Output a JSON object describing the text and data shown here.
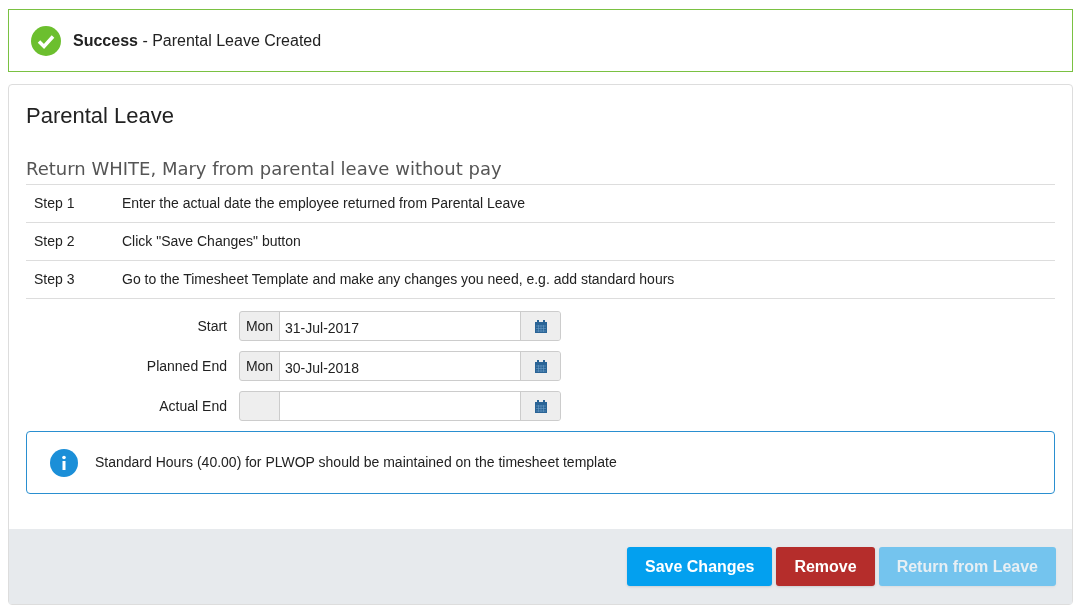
{
  "alert": {
    "title": "Success",
    "message": " - Parental Leave Created"
  },
  "panel": {
    "title": "Parental Leave",
    "subtitle": "Return WHITE, Mary from parental leave without pay"
  },
  "steps": [
    {
      "label": "Step 1",
      "text": "Enter the actual date the employee returned from Parental Leave"
    },
    {
      "label": "Step 2",
      "text": "Click \"Save Changes\" button"
    },
    {
      "label": "Step 3",
      "text": "Go to the Timesheet Template and make any changes you need, e.g. add standard hours"
    }
  ],
  "fields": [
    {
      "label": "Start",
      "day": "Mon",
      "value": "31-Jul-2017"
    },
    {
      "label": "Planned End",
      "day": "Mon",
      "value": "30-Jul-2018"
    },
    {
      "label": "Actual End"
    }
  ],
  "info": "Standard Hours (40.00) for PLWOP should be maintained on the timesheet template",
  "buttons": [
    {
      "label": "Save Changes",
      "kind": "primary",
      "disabled": false
    },
    {
      "label": "Remove",
      "kind": "danger",
      "disabled": false
    },
    {
      "label": "Return from Leave",
      "kind": "primary",
      "disabled": true
    }
  ]
}
